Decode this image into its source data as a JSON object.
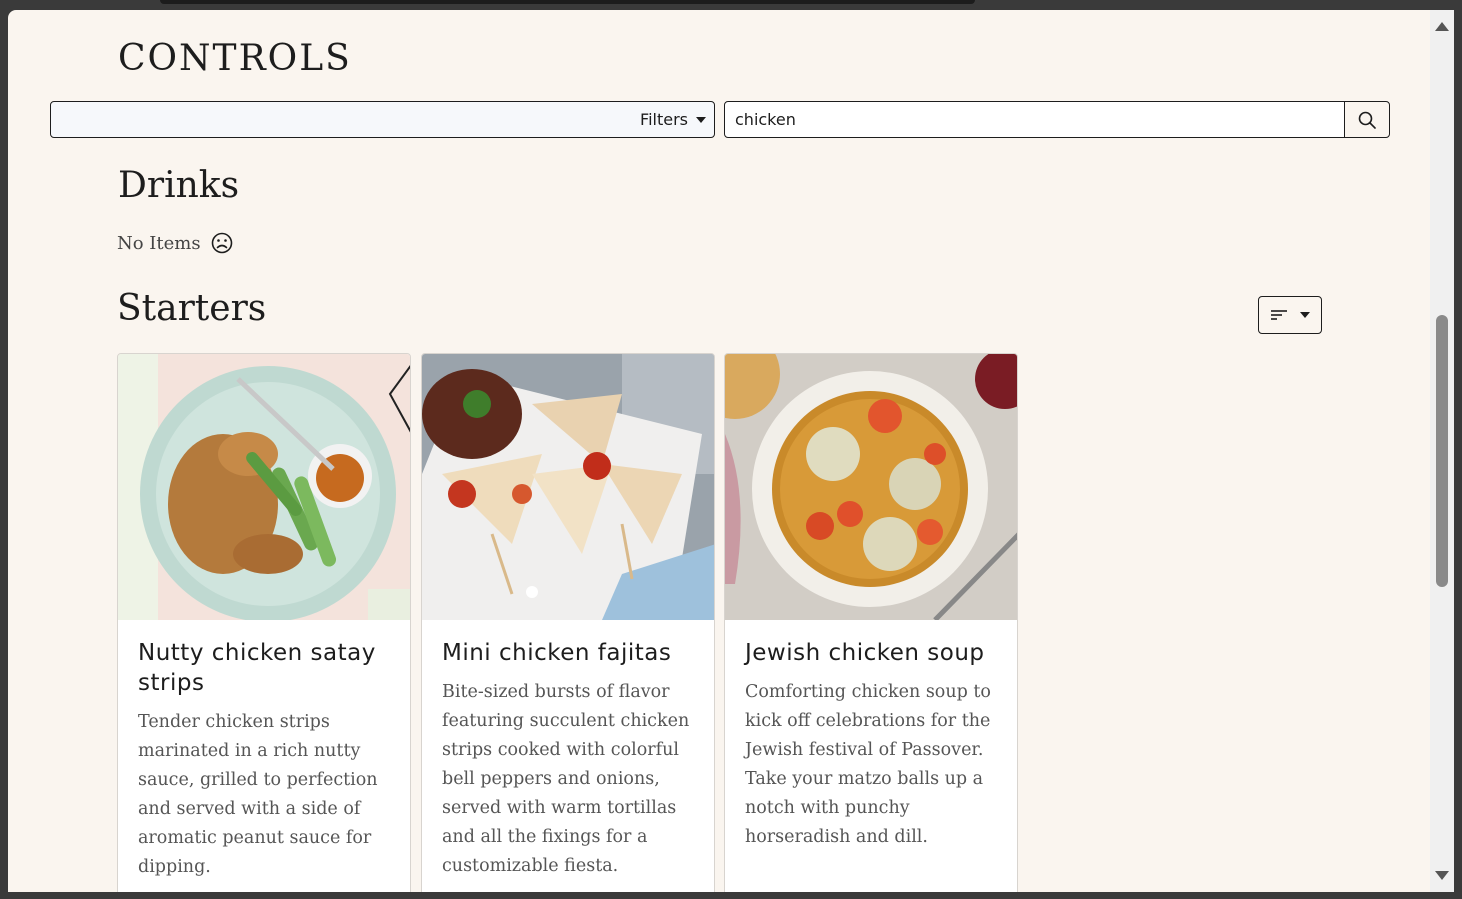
{
  "header": {
    "title": "CONTROLS"
  },
  "filters": {
    "label": "Filters"
  },
  "search": {
    "value": "chicken",
    "placeholder": ""
  },
  "sections": [
    {
      "title": "Drinks",
      "empty_text": "No Items"
    },
    {
      "title": "Starters",
      "items": [
        {
          "title": "Nutty chicken satay strips",
          "description": "Tender chicken strips marinated in a rich nutty sauce, grilled to perfection and served with a side of aromatic peanut sauce for dipping."
        },
        {
          "title": "Mini chicken fajitas",
          "description": "Bite-sized bursts of flavor featuring succulent chicken strips cooked with colorful bell peppers and onions, served with warm tortillas and all the fixings for a customizable fiesta."
        },
        {
          "title": "Jewish chicken soup",
          "description": "Comforting chicken soup to kick off celebrations for the Jewish festival of Passover. Take your matzo balls up a notch with punchy horseradish and dill."
        }
      ]
    }
  ],
  "icons": {
    "search": "search-icon",
    "filters_caret": "caret-down-icon",
    "empty": "sad-face-icon",
    "sort": "sort-icon"
  }
}
